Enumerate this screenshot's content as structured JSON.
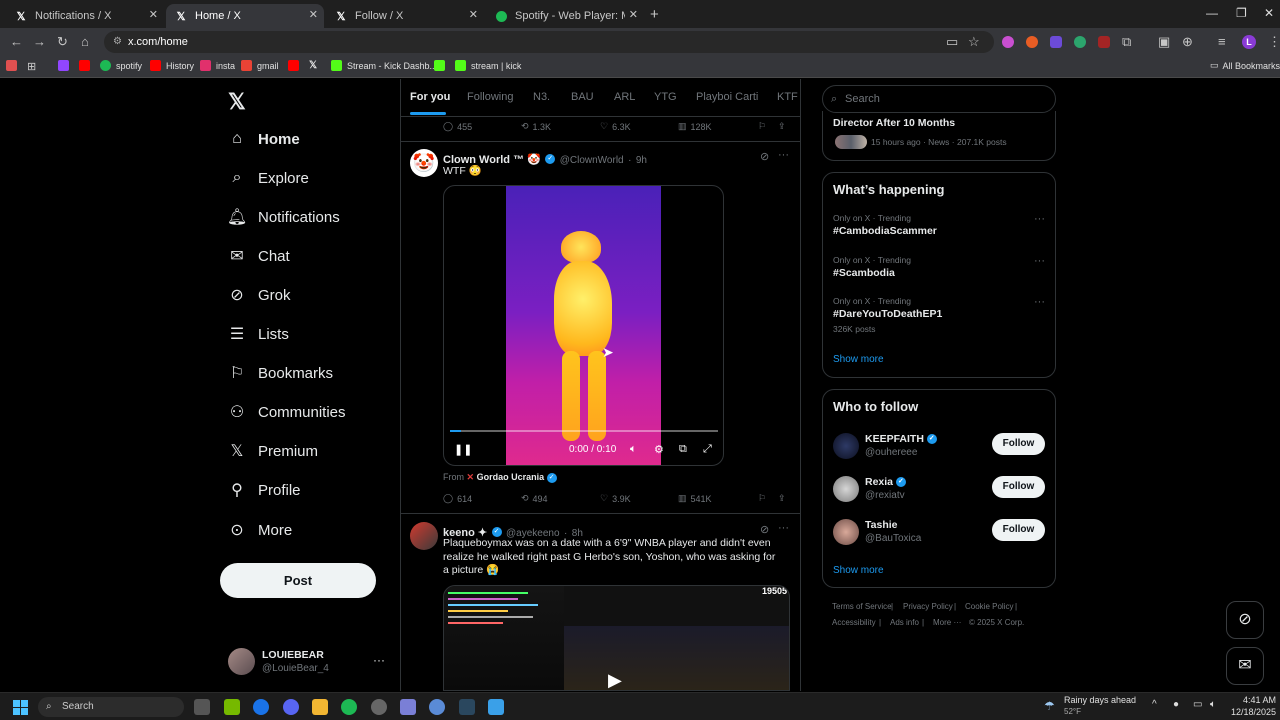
{
  "browser": {
    "tabs": [
      {
        "title": "Notifications / X",
        "active": false,
        "icon": "x-logo-icon"
      },
      {
        "title": "Home / X",
        "active": true,
        "icon": "x-logo-icon"
      },
      {
        "title": "Follow / X",
        "active": false,
        "icon": "x-logo-icon"
      },
      {
        "title": "Spotify - Web Player: Music for",
        "active": false,
        "icon": "spotify-icon"
      }
    ],
    "url": "x.com/home",
    "bookmarks": [
      {
        "label": "",
        "icon": "twitch-icon",
        "color": "#9146ff"
      },
      {
        "label": "",
        "icon": "youtube-icon",
        "color": "#ff0000"
      },
      {
        "label": "spotify",
        "icon": "spotify-icon",
        "color": "#1db954"
      },
      {
        "label": "History",
        "icon": "youtube-icon",
        "color": "#ff0000"
      },
      {
        "label": "insta",
        "icon": "instagram-icon",
        "color": "#e1306c"
      },
      {
        "label": "gmail",
        "icon": "gmail-icon",
        "color": "#ea4335"
      },
      {
        "label": "",
        "icon": "youtube-icon",
        "color": "#ff0000"
      },
      {
        "label": "",
        "icon": "x-logo-icon",
        "color": "#ffffff"
      },
      {
        "label": "Stream - Kick Dashb...",
        "icon": "kick-icon",
        "color": "#53fc18"
      },
      {
        "label": "",
        "icon": "kick-icon",
        "color": "#53fc18"
      },
      {
        "label": "stream | kick",
        "icon": "kick-icon",
        "color": "#53fc18"
      }
    ],
    "all_bookmarks": "All Bookmarks"
  },
  "sidebar": {
    "items": [
      {
        "label": "Home",
        "icon": "home-icon"
      },
      {
        "label": "Explore",
        "icon": "search-icon"
      },
      {
        "label": "Notifications",
        "icon": "bell-icon"
      },
      {
        "label": "Chat",
        "icon": "mail-icon"
      },
      {
        "label": "Grok",
        "icon": "grok-icon"
      },
      {
        "label": "Lists",
        "icon": "list-icon"
      },
      {
        "label": "Bookmarks",
        "icon": "bookmark-icon"
      },
      {
        "label": "Communities",
        "icon": "people-icon"
      },
      {
        "label": "Premium",
        "icon": "x-logo-icon"
      },
      {
        "label": "Profile",
        "icon": "person-icon"
      },
      {
        "label": "More",
        "icon": "more-circle-icon"
      }
    ],
    "post_label": "Post",
    "user": {
      "name": "LOUIEBEAR",
      "handle": "@LouieBear_4"
    }
  },
  "timeline": {
    "tabs": [
      "For you",
      "Following",
      "N3.",
      "BAU",
      "ARL",
      "YTG",
      "Playboi Carti",
      "KTF"
    ],
    "prev_actions": {
      "replies": "455",
      "reposts": "1.3K",
      "likes": "6.3K",
      "views": "128K"
    },
    "tweet1": {
      "name": "Clown World ™ 🤡",
      "handle": "@ClownWorld",
      "time": "9h",
      "text": "WTF 😳",
      "video_time": "0:00 / 0:10",
      "from_label": "From",
      "from_name": "Gordao Ucrania",
      "actions": {
        "replies": "614",
        "reposts": "494",
        "likes": "3.9K",
        "views": "541K"
      }
    },
    "tweet2": {
      "name": "keeno ✦",
      "handle": "@ayekeeno",
      "time": "8h",
      "text": "Plaqueboymax was on a date with a 6'9\" WNBA player and didn't even realize he walked right past G Herbo's son, Yoshon, who was asking for a picture 😭",
      "video_count": "19505"
    }
  },
  "right": {
    "search_placeholder": "Search",
    "news": {
      "title": "Director After 10 Months",
      "meta": "15 hours ago · News · 207.1K posts"
    },
    "happening_title": "What’s happening",
    "trends": [
      {
        "meta": "Only on X · Trending",
        "tag": "#CambodiaScammer",
        "posts": ""
      },
      {
        "meta": "Only on X · Trending",
        "tag": "#Scambodia",
        "posts": ""
      },
      {
        "meta": "Only on X · Trending",
        "tag": "#DareYouToDeathEP1",
        "posts": "326K posts"
      }
    ],
    "show_more": "Show more",
    "who_title": "Who to follow",
    "follow_label": "Follow",
    "who": [
      {
        "name": "KEEPFAITH",
        "handle": "@ouhereee"
      },
      {
        "name": "Rexia",
        "handle": "@rexiatv"
      },
      {
        "name": "Tashie",
        "handle": "@BauToxica"
      }
    ],
    "footer": {
      "terms": "Terms of Service",
      "privacy": "Privacy Policy",
      "cookie": "Cookie Policy",
      "access": "Accessibility",
      "ads": "Ads info",
      "more": "More ···",
      "copy": "© 2025 X Corp."
    }
  },
  "taskbar": {
    "search": "Search",
    "weather": "Rainy days ahead",
    "temp": "52°F",
    "time": "4:41 AM",
    "date": "12/18/2025"
  }
}
